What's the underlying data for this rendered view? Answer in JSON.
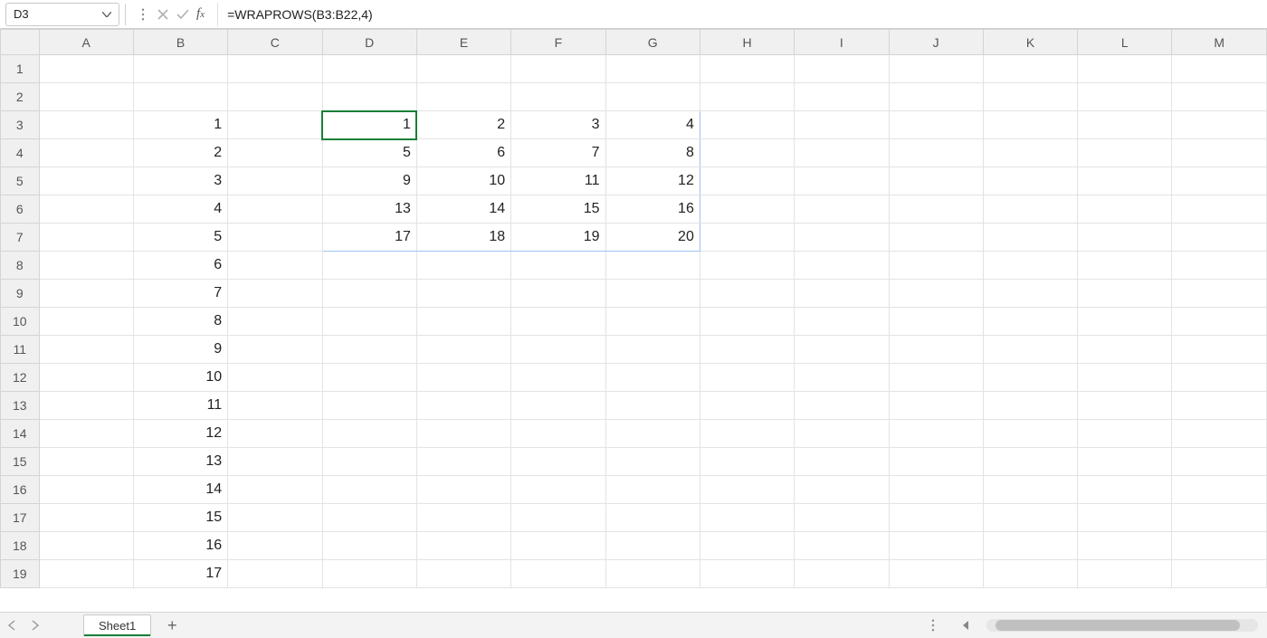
{
  "name_box": "D3",
  "formula": "=WRAPROWS(B3:B22,4)",
  "columns": [
    "A",
    "B",
    "C",
    "D",
    "E",
    "F",
    "G",
    "H",
    "I",
    "J",
    "K",
    "L",
    "M"
  ],
  "row_count": 19,
  "active_cell": {
    "row": 3,
    "col": "D"
  },
  "spill_range": {
    "r1": 3,
    "r2": 7,
    "c1": "D",
    "c2": "G"
  },
  "cells": {
    "B3": "1",
    "B4": "2",
    "B5": "3",
    "B6": "4",
    "B7": "5",
    "B8": "6",
    "B9": "7",
    "B10": "8",
    "B11": "9",
    "B12": "10",
    "B13": "11",
    "B14": "12",
    "B15": "13",
    "B16": "14",
    "B17": "15",
    "B18": "16",
    "B19": "17",
    "D3": "1",
    "E3": "2",
    "F3": "3",
    "G3": "4",
    "D4": "5",
    "E4": "6",
    "F4": "7",
    "G4": "8",
    "D5": "9",
    "E5": "10",
    "F5": "11",
    "G5": "12",
    "D6": "13",
    "E6": "14",
    "F6": "15",
    "G6": "16",
    "D7": "17",
    "E7": "18",
    "F7": "19",
    "G7": "20"
  },
  "sheet_tab": "Sheet1",
  "icons": {
    "chevron": "chevron-down-icon",
    "cancel": "x-icon",
    "confirm": "check-icon",
    "fx": "fx-icon",
    "kebab": "kebab-icon",
    "add": "plus-icon",
    "prev": "chevron-left-icon",
    "next": "chevron-right-icon",
    "scroll_left": "triangle-left-icon"
  }
}
